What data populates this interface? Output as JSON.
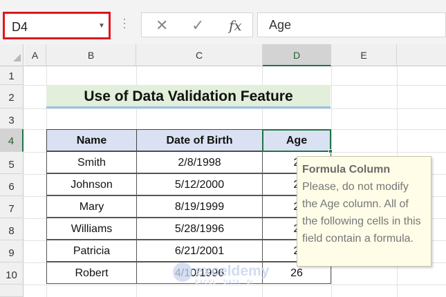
{
  "formula_bar": {
    "name_box": "D4",
    "formula": "Age",
    "fx_label": "fx"
  },
  "columns": [
    "A",
    "B",
    "C",
    "D",
    "E"
  ],
  "rows": [
    "1",
    "2",
    "3",
    "4",
    "5",
    "6",
    "7",
    "8",
    "9",
    "10"
  ],
  "sheet": {
    "title": "Use of Data Validation Feature",
    "headers": [
      "Name",
      "Date of Birth",
      "Age"
    ],
    "records": [
      {
        "name": "Smith",
        "dob": "2/8/1998",
        "age": "2"
      },
      {
        "name": "Johnson",
        "dob": "5/12/2000",
        "age": "2"
      },
      {
        "name": "Mary",
        "dob": "8/19/1999",
        "age": "2"
      },
      {
        "name": "Williams",
        "dob": "5/28/1996",
        "age": "2"
      },
      {
        "name": "Patricia",
        "dob": "6/21/2001",
        "age": "2"
      },
      {
        "name": "Robert",
        "dob": "4/10/1996",
        "age": "26"
      }
    ]
  },
  "tooltip": {
    "title": "Formula Column",
    "message": "Please, do not modify the Age column. All of the following cells in this field contain a formula."
  },
  "watermark": {
    "name": "exceldemy",
    "tagline": "EXCEL · DATA · BI"
  },
  "colors": {
    "accent": "#217346",
    "name_box_border": "#e0141e",
    "title_fill": "#e2efda",
    "header_fill": "#d9e1f2",
    "tooltip_fill": "#fffde8"
  }
}
